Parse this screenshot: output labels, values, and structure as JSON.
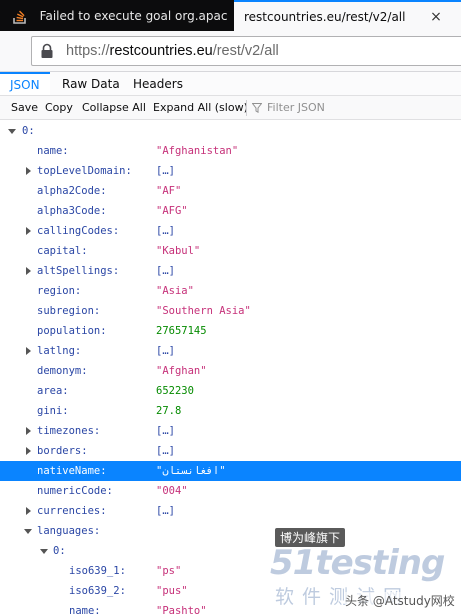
{
  "tabs": [
    {
      "title": "Failed to execute goal org.apac",
      "active": false,
      "icon": "stack-overflow-icon"
    },
    {
      "title": "restcountries.eu/rest/v2/all",
      "active": true,
      "close": "×"
    }
  ],
  "address": {
    "prefix": "https://",
    "host": "restcountries.eu",
    "path": "/rest/v2/all",
    "icon": "lock-icon"
  },
  "viewer_tabs": [
    "JSON",
    "Raw Data",
    "Headers"
  ],
  "toolbar": {
    "save": "Save",
    "copy": "Copy",
    "collapse": "Collapse All",
    "expand": "Expand All (slow)",
    "filter_placeholder": "Filter JSON"
  },
  "tree": {
    "root": "0:",
    "rows": [
      {
        "key": "name:",
        "value": "\"Afghanistan\"",
        "type": "str"
      },
      {
        "key": "topLevelDomain:",
        "value": "[…]",
        "type": "arr"
      },
      {
        "key": "alpha2Code:",
        "value": "\"AF\"",
        "type": "str"
      },
      {
        "key": "alpha3Code:",
        "value": "\"AFG\"",
        "type": "str"
      },
      {
        "key": "callingCodes:",
        "value": "[…]",
        "type": "arr"
      },
      {
        "key": "capital:",
        "value": "\"Kabul\"",
        "type": "str"
      },
      {
        "key": "altSpellings:",
        "value": "[…]",
        "type": "arr"
      },
      {
        "key": "region:",
        "value": "\"Asia\"",
        "type": "str"
      },
      {
        "key": "subregion:",
        "value": "\"Southern Asia\"",
        "type": "str"
      },
      {
        "key": "population:",
        "value": "27657145",
        "type": "num"
      },
      {
        "key": "latlng:",
        "value": "[…]",
        "type": "arr"
      },
      {
        "key": "demonym:",
        "value": "\"Afghan\"",
        "type": "str"
      },
      {
        "key": "area:",
        "value": "652230",
        "type": "num"
      },
      {
        "key": "gini:",
        "value": "27.8",
        "type": "num"
      },
      {
        "key": "timezones:",
        "value": "[…]",
        "type": "arr"
      },
      {
        "key": "borders:",
        "value": "[…]",
        "type": "arr"
      },
      {
        "key": "nativeName:",
        "value": "\"افغانستان\"",
        "type": "str",
        "selected": true
      },
      {
        "key": "numericCode:",
        "value": "\"004\"",
        "type": "str"
      },
      {
        "key": "currencies:",
        "value": "[…]",
        "type": "arr"
      },
      {
        "key": "languages:",
        "value": "",
        "type": "obj"
      }
    ],
    "lang_index": "0:",
    "lang_rows": [
      {
        "key": "iso639_1:",
        "value": "\"ps\""
      },
      {
        "key": "iso639_2:",
        "value": "\"pus\""
      },
      {
        "key": "name:",
        "value": "\"Pashto\""
      }
    ]
  },
  "watermark": {
    "badge": "博为峰旗下",
    "logo": "51testing",
    "sub": "软件测试网",
    "credit": "头条 @Atstudy网校"
  },
  "colors": {
    "accent": "#0a84ff",
    "key": "#2a46a5",
    "string": "#c63079",
    "number": "#058b00"
  }
}
